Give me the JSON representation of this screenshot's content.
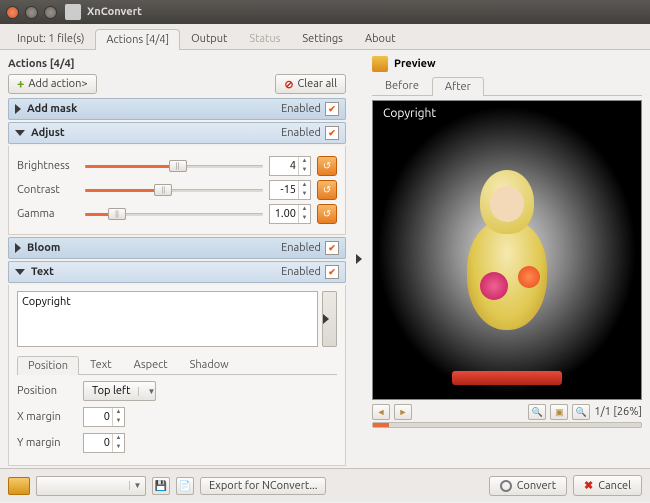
{
  "window": {
    "title": "XnConvert"
  },
  "tabs": {
    "input": "Input: 1 file(s)",
    "actions": "Actions [4/4]",
    "output": "Output",
    "status": "Status",
    "settings": "Settings",
    "about": "About"
  },
  "actions": {
    "header": "Actions [4/4]",
    "add_btn": "Add action>",
    "clear_btn": "Clear all",
    "enabled_label": "Enabled",
    "items": {
      "mask": {
        "title": "Add mask"
      },
      "adjust": {
        "title": "Adjust",
        "brightness_label": "Brightness",
        "brightness_value": "4",
        "contrast_label": "Contrast",
        "contrast_value": "-15",
        "gamma_label": "Gamma",
        "gamma_value": "1.00"
      },
      "bloom": {
        "title": "Bloom"
      },
      "text": {
        "title": "Text",
        "content": "Copyright",
        "subtabs": {
          "position": "Position",
          "text": "Text",
          "aspect": "Aspect",
          "shadow": "Shadow"
        },
        "position_label": "Position",
        "position_value": "Top left",
        "xmargin_label": "X margin",
        "xmargin_value": "0",
        "ymargin_label": "Y margin",
        "ymargin_value": "0"
      }
    }
  },
  "preview": {
    "header": "Preview",
    "before_tab": "Before",
    "after_tab": "After",
    "overlay_text": "Copyright",
    "zoom_status": "1/1 [26%]"
  },
  "footer": {
    "export_btn": "Export for NConvert...",
    "convert_btn": "Convert",
    "cancel_btn": "Cancel"
  }
}
